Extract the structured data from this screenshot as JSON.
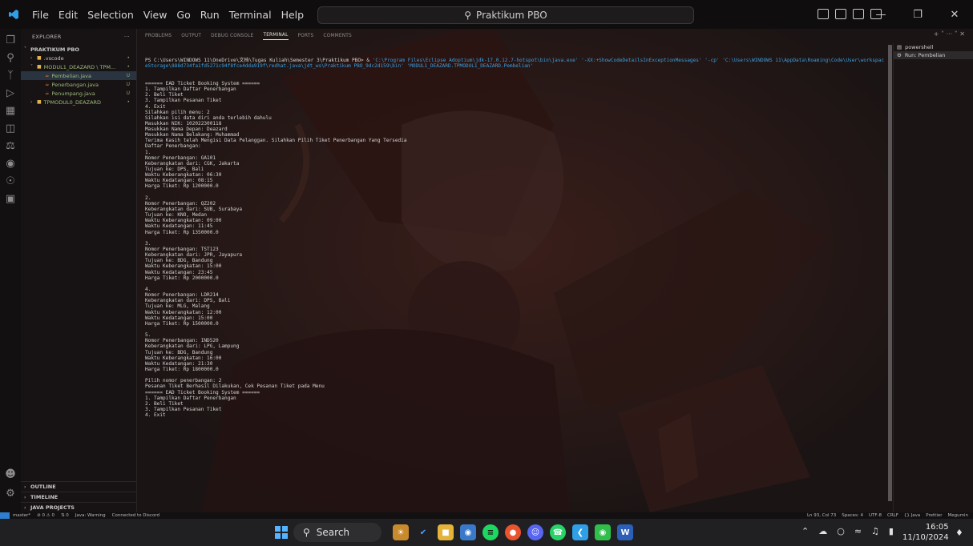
{
  "titlebar": {
    "menu": [
      "File",
      "Edit",
      "Selection",
      "View",
      "Go",
      "Run",
      "Terminal",
      "Help"
    ],
    "search": "Praktikum PBO",
    "accent": "#2f7fd1"
  },
  "sidebar": {
    "explorer_label": "EXPLORER",
    "more": "···",
    "project": "PRAKTIKUM PBO",
    "items": [
      {
        "label": ".vscode",
        "marker": "•"
      },
      {
        "label": "MODUL1_DEAZARD \\ TPM...",
        "marker": "•"
      },
      {
        "label": "Pembelian.java",
        "marker": "U"
      },
      {
        "label": "Penerbangan.java",
        "marker": "U"
      },
      {
        "label": "Penumpang.java",
        "marker": "U"
      },
      {
        "label": "TPMODUL0_DEAZARD",
        "marker": "•"
      }
    ],
    "bottom": [
      "OUTLINE",
      "TIMELINE",
      "JAVA PROJECTS"
    ]
  },
  "panel": {
    "tabs": [
      "PROBLEMS",
      "OUTPUT",
      "DEBUG CONSOLE",
      "TERMINAL",
      "PORTS",
      "COMMENTS"
    ],
    "actions": "+ ˅  ···  ˅  ✕"
  },
  "terminal": {
    "prompt": "PS C:\\Users\\WINDOWS 11\\OneDrive\\文档\\Tugas Kuliah\\Semester 3\\Praktikum PBO> & ",
    "cmd_args": "'C:\\Program Files\\Eclipse Adoptium\\jdk-17.0.12.7-hotspot\\bin\\java.exe' '-XX:+ShowCodeDetailsInExceptionMessages' '-cp' 'C:\\Users\\WINDOWS 11\\AppData\\Roaming\\Code\\User\\workspaceStorage\\888d734fa1fd5271c94f8fce4dda919f\\redhat.java\\jdt_ws\\Praktikum PBO_9dc2d159\\bin' 'MODUL1_DEAZARD.TPMODUL1_DEAZARD.Pembelian'",
    "lines": [
      "====== EAD Ticket Booking System ======",
      "1. Tampilkan Daftar Penerbangan",
      "2. Beli Tiket",
      "3. Tampilkan Pesanan Tiket",
      "4. Exit",
      "Silahkan pilih menu: 2",
      "Silahkan isi data diri anda terlebih dahulu",
      "Masukkan NIK: 102022300118",
      "Masukkan Nama Depan: Deazard",
      "Masukkan Nama Belakang: Muhammad",
      "Terima Kasih telah Mengisi Data Pelanggan. Silahkan Pilih Tiket Penerbangan Yang Tersedia",
      "Daftar Penerbangan:",
      "1.",
      "Nomor Penerbangan: GA101",
      "Keberangkatan dari: CGK, Jakarta",
      "Tujuan ke: DPS, Bali",
      "Waktu Keberangkatan: 06:30",
      "Waktu Kedatangan: 08:15",
      "Harga Tiket: Rp 1200000.0",
      "",
      "2.",
      "Nomor Penerbangan: QZ202",
      "Keberangkatan dari: SUB, Surabaya",
      "Tujuan ke: KNO, Medan",
      "Waktu Keberangkatan: 09:00",
      "Waktu Kedatangan: 11:45",
      "Harga Tiket: Rp 1350000.0",
      "",
      "3.",
      "Nomor Penerbangan: TST123",
      "Keberangkatan dari: JPR, Jayapura",
      "Tujuan ke: BDG, Bandung",
      "Waktu Keberangkatan: 15:00",
      "Waktu Kedatangan: 23:45",
      "Harga Tiket: Rp 2000000.0",
      "",
      "4.",
      "Nomor Penerbangan: LDR214",
      "Keberangkatan dari: DPS, Bali",
      "Tujuan ke: MLG, Malang",
      "Waktu Keberangkatan: 12:00",
      "Waktu Kedatangan: 15:00",
      "Harga Tiket: Rp 1500000.0",
      "",
      "5.",
      "Nomor Penerbangan: IND520",
      "Keberangkatan dari: LPG, Lampung",
      "Tujuan ke: BDG, Bandung",
      "Waktu Keberangkatan: 16:00",
      "Waktu Kedatangan: 21:30",
      "Harga Tiket: Rp 1800000.0",
      "",
      "Pilih nomor penerbangan: 2",
      "Pesanan Tiket Berhasil Dilakukan, Cek Pesanan Tiket pada Menu",
      "====== EAD Ticket Booking System ======",
      "1. Tampilkan Daftar Penerbangan",
      "2. Beli Tiket",
      "3. Tampilkan Pesanan Tiket",
      "4. Exit"
    ],
    "list": [
      "powershell",
      "Run: Pembelian"
    ]
  },
  "statusbar": {
    "left": [
      "master*",
      "⊘ 0 ⚠ 0",
      "⇅ 0",
      "Java: Warning",
      "Connected to Discord"
    ],
    "right": [
      "Ln 93, Col 73",
      "Spaces: 4",
      "UTF-8",
      "CRLF",
      "{} Java",
      "Prettier",
      "Megumin"
    ]
  },
  "taskbar": {
    "search": "Search",
    "time": "16:05",
    "date": "11/10/2024"
  }
}
